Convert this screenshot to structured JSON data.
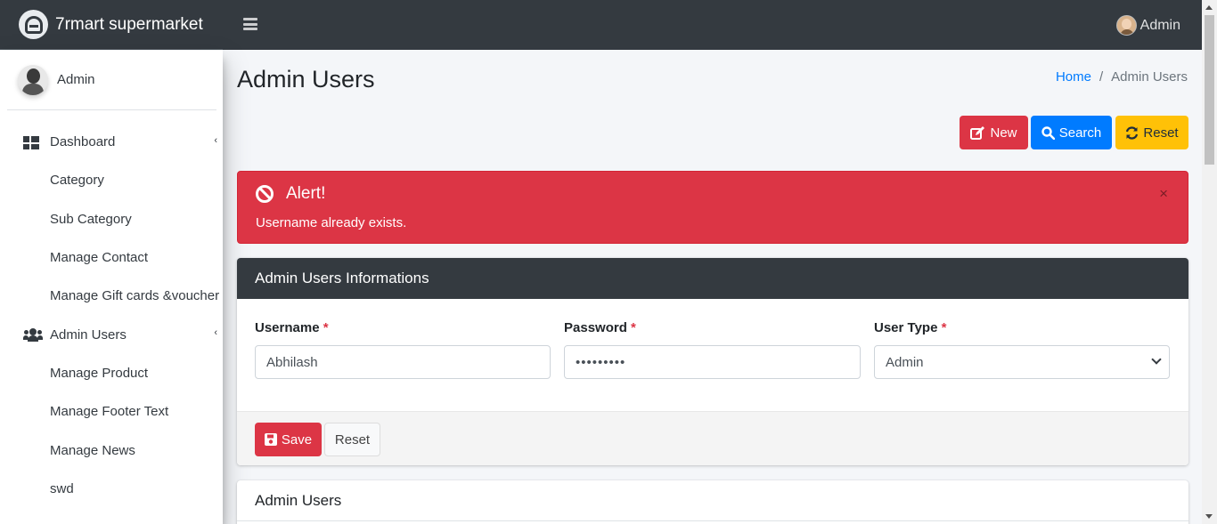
{
  "brand": {
    "name": "7rmart supermarket"
  },
  "topbar": {
    "user_name": "Admin"
  },
  "sidebar": {
    "user_name": "Admin",
    "items": [
      {
        "label": "Dashboard",
        "type": "parent",
        "icon": "dashboard-icon"
      },
      {
        "label": "Category",
        "type": "child"
      },
      {
        "label": "Sub Category",
        "type": "child"
      },
      {
        "label": "Manage Contact",
        "type": "child"
      },
      {
        "label": "Manage Gift cards &voucher",
        "type": "child"
      },
      {
        "label": "Admin Users",
        "type": "parent",
        "icon": "users-icon"
      },
      {
        "label": "Manage Product",
        "type": "child"
      },
      {
        "label": "Manage Footer Text",
        "type": "child"
      },
      {
        "label": "Manage News",
        "type": "child"
      },
      {
        "label": "swd",
        "type": "child"
      }
    ]
  },
  "page": {
    "title": "Admin Users",
    "breadcrumb": {
      "home": "Home",
      "separator": "/",
      "current": "Admin Users"
    }
  },
  "toolbar": {
    "new_label": "New",
    "search_label": "Search",
    "reset_label": "Reset"
  },
  "alert": {
    "title": "Alert!",
    "message": "Username already exists.",
    "close": "×"
  },
  "form": {
    "title": "Admin Users Informations",
    "username": {
      "label": "Username",
      "value": "Abhilash"
    },
    "password": {
      "label": "Password",
      "value": "•••••••••"
    },
    "user_type": {
      "label": "User Type",
      "value": "Admin"
    },
    "required_mark": "*",
    "save_label": "Save",
    "reset_label": "Reset"
  },
  "table_card": {
    "title": "Admin Users"
  },
  "colors": {
    "danger": "#dc3545",
    "primary": "#007bff",
    "warning": "#ffc107",
    "dark": "#343a40"
  }
}
